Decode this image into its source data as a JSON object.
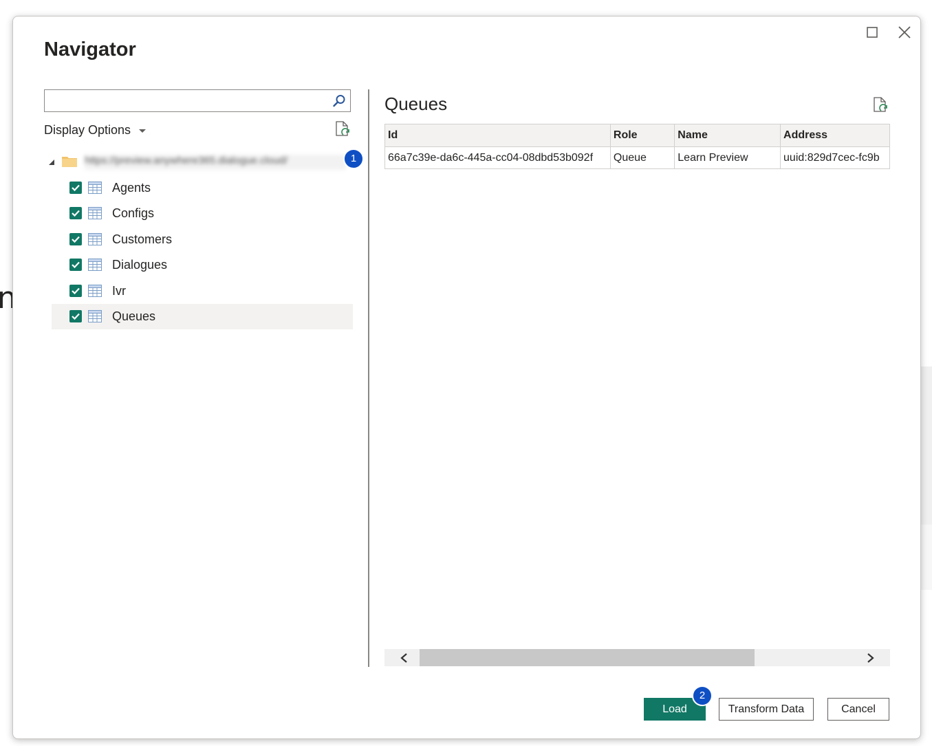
{
  "window": {
    "title": "Navigator",
    "maximize_icon": "maximize-icon",
    "close_icon": "close-icon"
  },
  "left_pane": {
    "search": {
      "value": "",
      "placeholder": ""
    },
    "display_options_label": "Display Options",
    "root": {
      "url": "https://preview.anywhere365.dialogue.cloud/",
      "badge": "1"
    },
    "items": [
      {
        "label": "Agents",
        "checked": true,
        "selected": false
      },
      {
        "label": "Configs",
        "checked": true,
        "selected": false
      },
      {
        "label": "Customers",
        "checked": true,
        "selected": false
      },
      {
        "label": "Dialogues",
        "checked": true,
        "selected": false
      },
      {
        "label": "Ivr",
        "checked": true,
        "selected": false
      },
      {
        "label": "Queues",
        "checked": true,
        "selected": true
      }
    ]
  },
  "preview": {
    "title": "Queues",
    "columns": [
      "Id",
      "Role",
      "Name",
      "Address"
    ],
    "rows": [
      [
        "66a7c39e-da6c-445a-cc04-08dbd53b092f",
        "Queue",
        "Learn Preview",
        "uuid:829d7cec-fc9b"
      ]
    ]
  },
  "footer": {
    "load_label": "Load",
    "load_badge": "2",
    "transform_label": "Transform Data",
    "cancel_label": "Cancel"
  },
  "background": {
    "partial_text": "n"
  },
  "colors": {
    "accent": "#117865",
    "badge": "#0f4fc4"
  }
}
